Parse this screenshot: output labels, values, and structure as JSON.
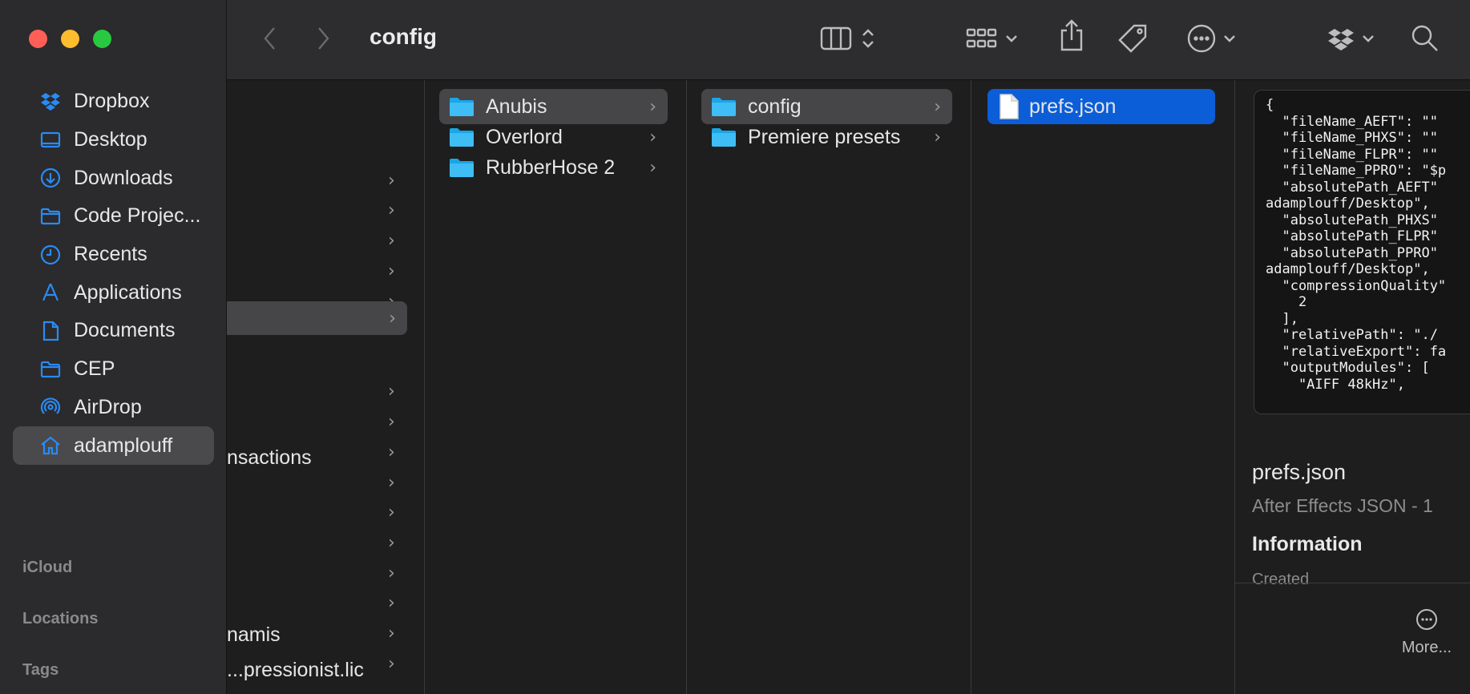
{
  "window": {
    "title": "config"
  },
  "sidebar": {
    "items": [
      {
        "label": "Dropbox",
        "icon": "dropbox-icon"
      },
      {
        "label": "Desktop",
        "icon": "desktop-icon"
      },
      {
        "label": "Downloads",
        "icon": "downloads-icon"
      },
      {
        "label": "Code Projec...",
        "icon": "folder-icon"
      },
      {
        "label": "Recents",
        "icon": "clock-icon"
      },
      {
        "label": "Applications",
        "icon": "applications-icon"
      },
      {
        "label": "Documents",
        "icon": "document-icon"
      },
      {
        "label": "CEP",
        "icon": "folder-icon"
      },
      {
        "label": "AirDrop",
        "icon": "airdrop-icon"
      },
      {
        "label": "adamplouff",
        "icon": "home-icon"
      }
    ],
    "sections": {
      "icloud": "iCloud",
      "locations": "Locations",
      "tags": "Tags"
    }
  },
  "column1": {
    "fragments": {
      "transactions": "nsactions",
      "dynamis": "namis",
      "license": "...pressionist.lic"
    }
  },
  "column2": {
    "items": [
      {
        "label": "Anubis"
      },
      {
        "label": "Overlord"
      },
      {
        "label": "RubberHose 2"
      }
    ]
  },
  "column3": {
    "items": [
      {
        "label": "config"
      },
      {
        "label": "Premiere presets"
      }
    ]
  },
  "column4": {
    "items": [
      {
        "label": "prefs.json"
      }
    ]
  },
  "preview": {
    "code_lines": [
      "{",
      "  \"fileName_AEFT\": \"\"",
      "  \"fileName_PHXS\": \"\"",
      "  \"fileName_FLPR\": \"\"",
      "  \"fileName_PPRO\": \"$p",
      "  \"absolutePath_AEFT\"",
      "adamplouff/Desktop\",",
      "  \"absolutePath_PHXS\"",
      "  \"absolutePath_FLPR\"",
      "  \"absolutePath_PPRO\"",
      "adamplouff/Desktop\",",
      "  \"compressionQuality\"",
      "    2",
      "  ],",
      "  \"relativePath\": \"./",
      "  \"relativeExport\": fa",
      "  \"outputModules\": [",
      "    \"AIFF 48kHz\","
    ],
    "file_name": "prefs.json",
    "file_kind": "After Effects JSON - 1",
    "info_heading": "Information",
    "created_label": "Created",
    "more_label": "More..."
  }
}
